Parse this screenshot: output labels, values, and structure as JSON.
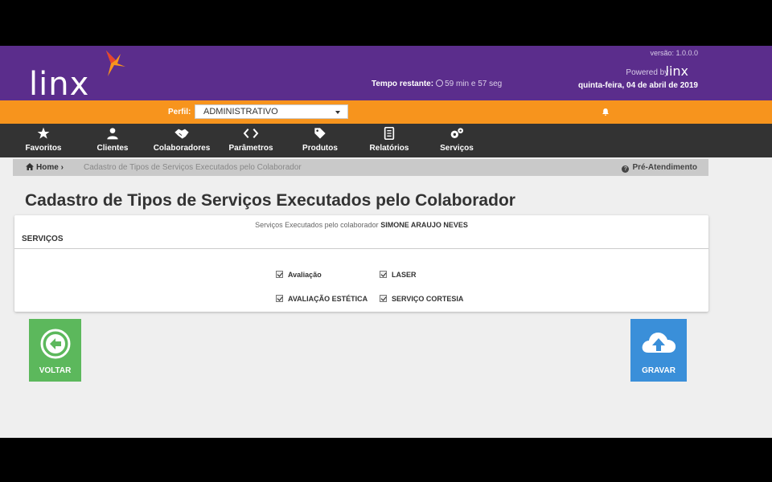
{
  "header": {
    "logo_text": "linx",
    "timer_label": "Tempo restante:",
    "timer_value": "59 min e 57 seg",
    "version": "versão: 1.0.0.0",
    "powered_by": "Powered by",
    "powered_logo": "linx",
    "date": "quinta-feira, 04 de abril de 2019",
    "brand_color": "#5b2d8c"
  },
  "toolbar": {
    "perfil_label": "Perfil:",
    "perfil_value": "ADMINISTRATIVO",
    "accent_color": "#f7941d"
  },
  "nav": {
    "items": [
      {
        "label": "Favoritos",
        "icon": "star-icon"
      },
      {
        "label": "Clientes",
        "icon": "user-icon"
      },
      {
        "label": "Colaboradores",
        "icon": "handshake-icon"
      },
      {
        "label": "Parâmetros",
        "icon": "code-icon"
      },
      {
        "label": "Produtos",
        "icon": "tag-icon"
      },
      {
        "label": "Relatórios",
        "icon": "report-icon"
      },
      {
        "label": "Serviços",
        "icon": "gears-icon"
      }
    ]
  },
  "breadcrumb": {
    "home": "Home",
    "separator": "›",
    "current": "Cadastro de Tipos de Serviços Executados pelo Colaborador",
    "right_link": "Pré-Atendimento"
  },
  "page": {
    "title": "Cadastro de Tipos de Serviços Executados pelo Colaborador"
  },
  "panel": {
    "subtitle_prefix": "Serviços Executados pelo colaborador",
    "collaborator": "SIMONE ARAUJO NEVES",
    "section_label": "SERVIÇOS",
    "services": [
      {
        "label": "Avaliação",
        "checked": true
      },
      {
        "label": "LASER",
        "checked": true
      },
      {
        "label": "AVALIAÇÃO ESTÉTICA",
        "checked": true
      },
      {
        "label": "SERVIÇO CORTESIA",
        "checked": true
      }
    ]
  },
  "actions": {
    "back_label": "VOLTAR",
    "save_label": "GRAVAR",
    "back_color": "#5cb85c",
    "save_color": "#3a8fd9"
  }
}
